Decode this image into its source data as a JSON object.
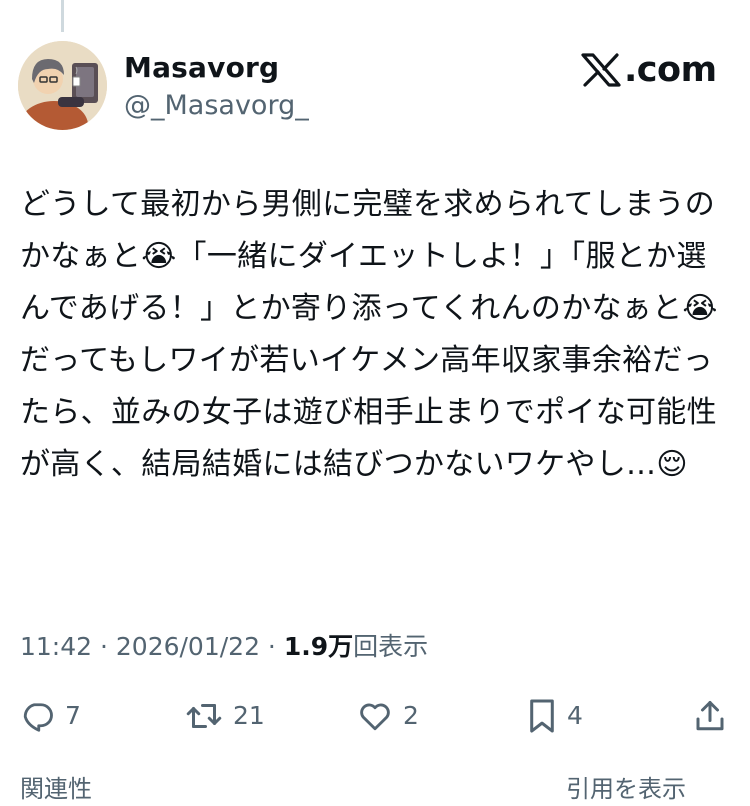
{
  "author": {
    "name": "Masavorg",
    "handle": "@_Masavorg_",
    "avatar_icon": "avatar-illustration"
  },
  "brand": {
    "text": ".com",
    "icon": "x-logo-icon"
  },
  "post": {
    "text": "どうして最初から男側に完璧を求められてしまうのかなぁと😭「一緒にダイエットしよ！」「服とか選んであげる！」とか寄り添ってくれんのかなぁと😭\nだってもしワイが若いイケメン高年収家事余裕だったら、並みの女子は遊び相手止まりでポイな可能性が高く、結局結婚には結びつかないワケやし…😌"
  },
  "meta": {
    "time": "11:42",
    "separator": " · ",
    "date": "2026/01/22",
    "views_number": "1.9万",
    "views_label": "回表示"
  },
  "actions": {
    "reply": {
      "icon": "reply-icon",
      "count": "7"
    },
    "retweet": {
      "icon": "retweet-icon",
      "count": "21"
    },
    "like": {
      "icon": "heart-icon",
      "count": "2"
    },
    "bookmark": {
      "icon": "bookmark-icon",
      "count": "4"
    },
    "share": {
      "icon": "share-icon"
    }
  },
  "footer": {
    "left": "関連性",
    "right": "引用を表示"
  },
  "colors": {
    "text_primary": "#0f1419",
    "text_secondary": "#536471",
    "thread_line": "#cfd9de"
  }
}
